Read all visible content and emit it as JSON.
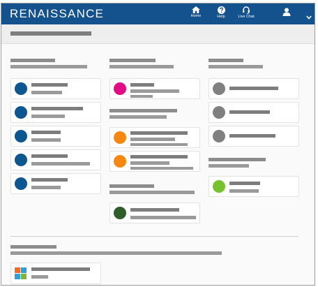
{
  "header": {
    "brand": "RENAISSANCE",
    "nav": [
      {
        "id": "home",
        "label": "Home",
        "icon": "home-icon"
      },
      {
        "id": "help",
        "label": "Help",
        "icon": "help-icon"
      },
      {
        "id": "live-chat",
        "label": "Live Chat",
        "icon": "headset-icon"
      }
    ],
    "user_icon": "user-icon",
    "menu_icon": "chevron-down-icon",
    "background": "#13528c"
  },
  "colors": {
    "blue": "#0e5690",
    "magenta": "#e20c84",
    "orange": "#f7870f",
    "green": "#77c12f",
    "dark_green": "#2f5e2a",
    "gray": "#808080",
    "tile_orange": "#f46a24",
    "tile_blue": "#2f9ed9",
    "tile_green": "#7cb53a",
    "tile_yellow": "#f8b81c"
  }
}
